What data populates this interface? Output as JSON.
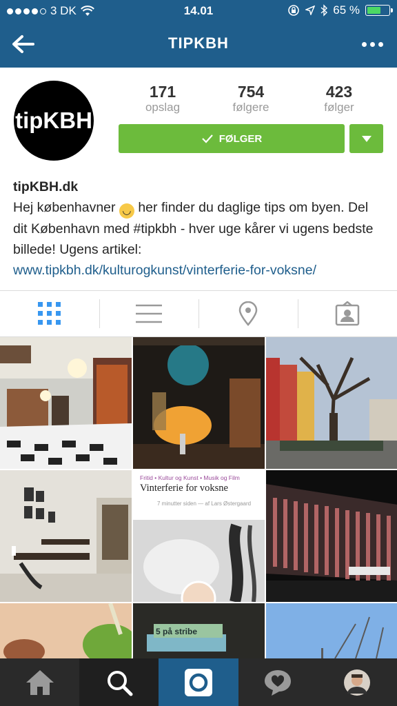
{
  "status": {
    "carrier": "3 DK",
    "time": "14.01",
    "battery": "65 %",
    "battery_level": 0.65,
    "signal_bars": 4
  },
  "nav": {
    "title": "TIPKBH"
  },
  "profile": {
    "avatar_text": "tipKBH",
    "stats": [
      {
        "value": "171",
        "label": "opslag"
      },
      {
        "value": "754",
        "label": "følgere"
      },
      {
        "value": "423",
        "label": "følger"
      }
    ],
    "follow_label": "FØLGER",
    "name": "tipKBH.dk",
    "bio_part1": "Hej københavner",
    "bio_emoji": "😊",
    "bio_part2": " her finder du daglige tips om byen. Del dit København med #tipkbh - hver uge kårer vi ugens bedste billede! Ugens artikel:",
    "link": "www.tipkbh.dk/kulturogkunst/vinterferie-for-voksne/"
  },
  "post5": {
    "tags": "Fritid • Kultur og Kunst • Musik og Film",
    "title": "Vinterferie for voksne",
    "meta": "7 minutter siden — af Lars Østergaard"
  },
  "post8": {
    "text": "5 på stribe"
  },
  "colors": {
    "brand": "#1f5e8c",
    "follow_green": "#6cbb3c"
  }
}
